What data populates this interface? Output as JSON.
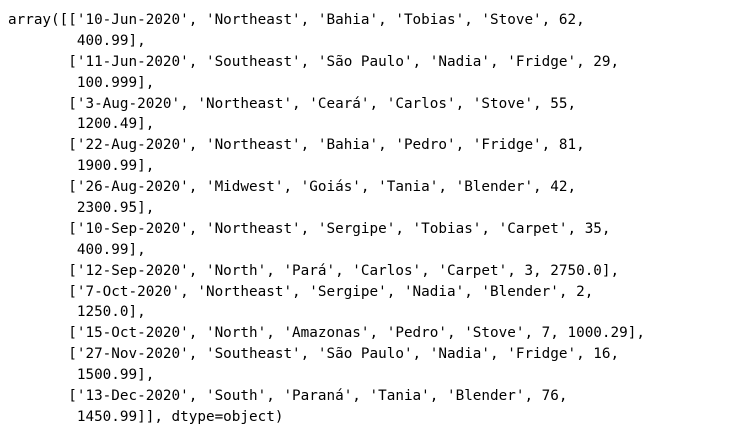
{
  "output": {
    "lines": [
      "array([['10-Jun-2020', 'Northeast', 'Bahia', 'Tobias', 'Stove', 62,",
      "        400.99],",
      "       ['11-Jun-2020', 'Southeast', 'São Paulo', 'Nadia', 'Fridge', 29,",
      "        100.999],",
      "       ['3-Aug-2020', 'Northeast', 'Ceará', 'Carlos', 'Stove', 55,",
      "        1200.49],",
      "       ['22-Aug-2020', 'Northeast', 'Bahia', 'Pedro', 'Fridge', 81,",
      "        1900.99],",
      "       ['26-Aug-2020', 'Midwest', 'Goiás', 'Tania', 'Blender', 42,",
      "        2300.95],",
      "       ['10-Sep-2020', 'Northeast', 'Sergipe', 'Tobias', 'Carpet', 35,",
      "        400.99],",
      "       ['12-Sep-2020', 'North', 'Pará', 'Carlos', 'Carpet', 3, 2750.0],",
      "       ['7-Oct-2020', 'Northeast', 'Sergipe', 'Nadia', 'Blender', 2,",
      "        1250.0],",
      "       ['15-Oct-2020', 'North', 'Amazonas', 'Pedro', 'Stove', 7, 1000.29],",
      "       ['27-Nov-2020', 'Southeast', 'São Paulo', 'Nadia', 'Fridge', 16,",
      "        1500.99],",
      "       ['13-Dec-2020', 'South', 'Paraná', 'Tania', 'Blender', 76,",
      "        1450.99]], dtype=object)"
    ]
  }
}
